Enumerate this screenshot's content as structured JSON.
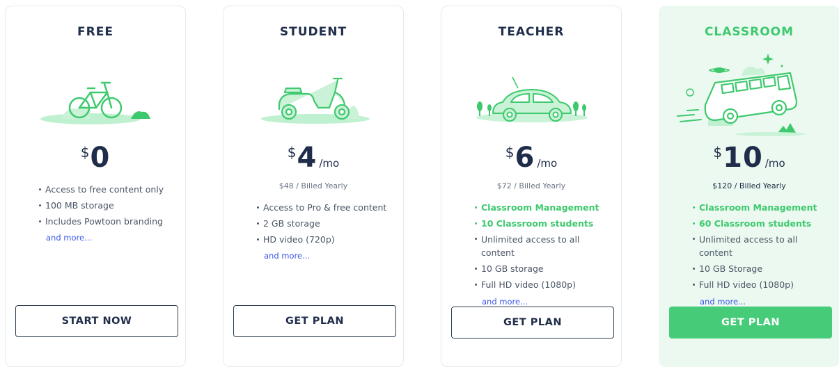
{
  "plans": [
    {
      "title": "FREE",
      "illustration": "bicycle-icon",
      "currency": "$",
      "amount": "0",
      "period": "",
      "billed": "",
      "features": [
        {
          "text": "Access to free content only"
        },
        {
          "text": "100 MB storage"
        },
        {
          "text": "Includes Powtoon branding"
        }
      ],
      "more_label": "and more...",
      "button_label": "START NOW"
    },
    {
      "title": "STUDENT",
      "illustration": "scooter-icon",
      "currency": "$",
      "amount": "4",
      "period": "/mo",
      "billed": "$48 / Billed Yearly",
      "features": [
        {
          "text": "Access to Pro & free content"
        },
        {
          "text": "2 GB storage"
        },
        {
          "text": "HD video (720p)"
        }
      ],
      "more_label": "and more...",
      "button_label": "GET PLAN"
    },
    {
      "title": "TEACHER",
      "illustration": "car-icon",
      "currency": "$",
      "amount": "6",
      "period": "/mo",
      "billed": "$72 / Billed Yearly",
      "features": [
        {
          "text": "Classroom Management"
        },
        {
          "text": "10 Classroom students"
        },
        {
          "text": "Unlimited access to all content"
        },
        {
          "text": "10 GB storage"
        },
        {
          "text": "Full HD video (1080p)"
        }
      ],
      "more_label": "and more...",
      "button_label": "GET PLAN"
    },
    {
      "title": "CLASSROOM",
      "illustration": "school-bus-icon",
      "currency": "$",
      "amount": "10",
      "period": "/mo",
      "billed": "$120 / Billed Yearly",
      "features": [
        {
          "text": "Classroom Management"
        },
        {
          "text": "60 Classroom students"
        },
        {
          "text": "Unlimited access to all content"
        },
        {
          "text": "10 GB Storage"
        },
        {
          "text": "Full HD video (1080p)"
        }
      ],
      "more_label": "and more...",
      "button_label": "GET PLAN"
    }
  ],
  "colors": {
    "accent_green": "#3ec96e",
    "button_green": "#46cc78",
    "link_blue": "#3a57e8",
    "title_dark": "#1f2d4a",
    "highlight_bg": "#ecf9f0"
  }
}
